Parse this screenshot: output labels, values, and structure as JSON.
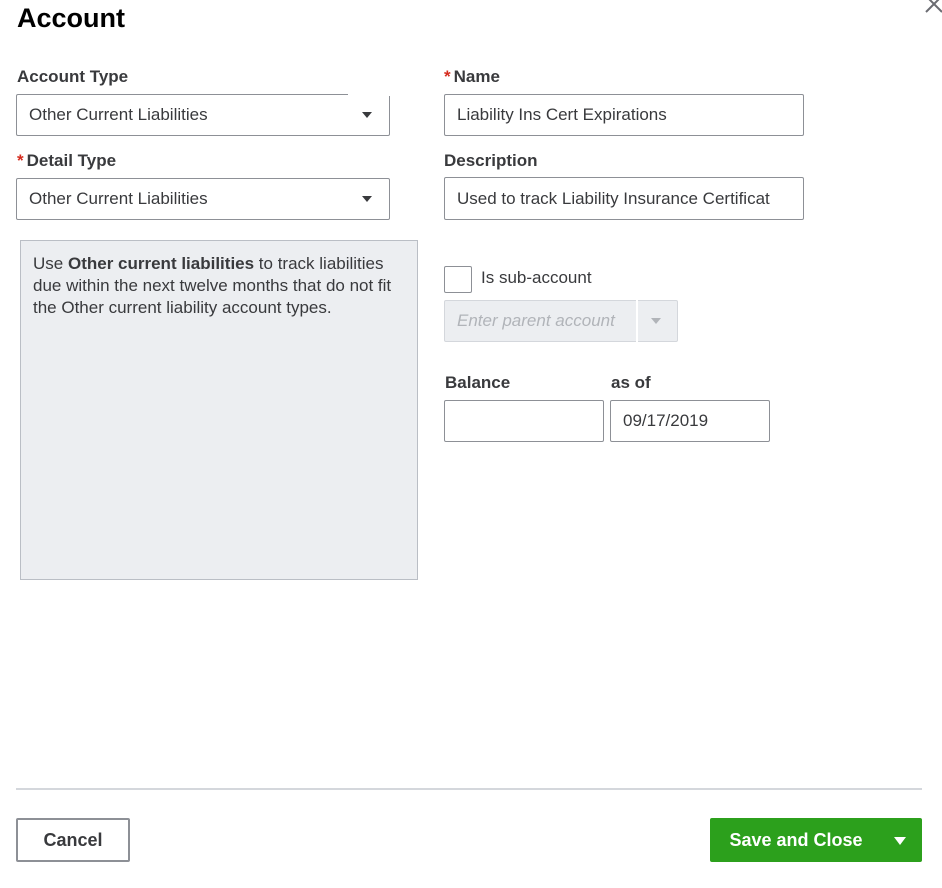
{
  "dialog": {
    "title": "Account"
  },
  "form": {
    "account_type": {
      "label": "Account Type",
      "value": "Other Current Liabilities"
    },
    "detail_type": {
      "required_mark": "*",
      "label": "Detail Type",
      "value": "Other Current Liabilities"
    },
    "name": {
      "required_mark": "*",
      "label": "Name",
      "value": "Liability Ins Cert Expirations"
    },
    "description": {
      "label": "Description",
      "value": "Used to track Liability Insurance Certificat"
    },
    "sub_account": {
      "label": "Is sub-account",
      "checked": false,
      "parent_placeholder": "Enter parent account"
    },
    "balance": {
      "label": "Balance",
      "value": ""
    },
    "as_of": {
      "label": "as of",
      "value": "09/17/2019"
    }
  },
  "help": {
    "prefix": "Use ",
    "bold": "Other current liabilities",
    "suffix": " to track liabilities due within the next twelve months that do not fit the Other current liability account types."
  },
  "footer": {
    "cancel_label": "Cancel",
    "save_label": "Save and Close"
  },
  "icons": {
    "close": "close-icon",
    "dropdown": "chevron-down-icon"
  },
  "colors": {
    "required": "#d52b1e",
    "primary_button": "#2ca01c",
    "help_panel_bg": "#eceef1"
  }
}
